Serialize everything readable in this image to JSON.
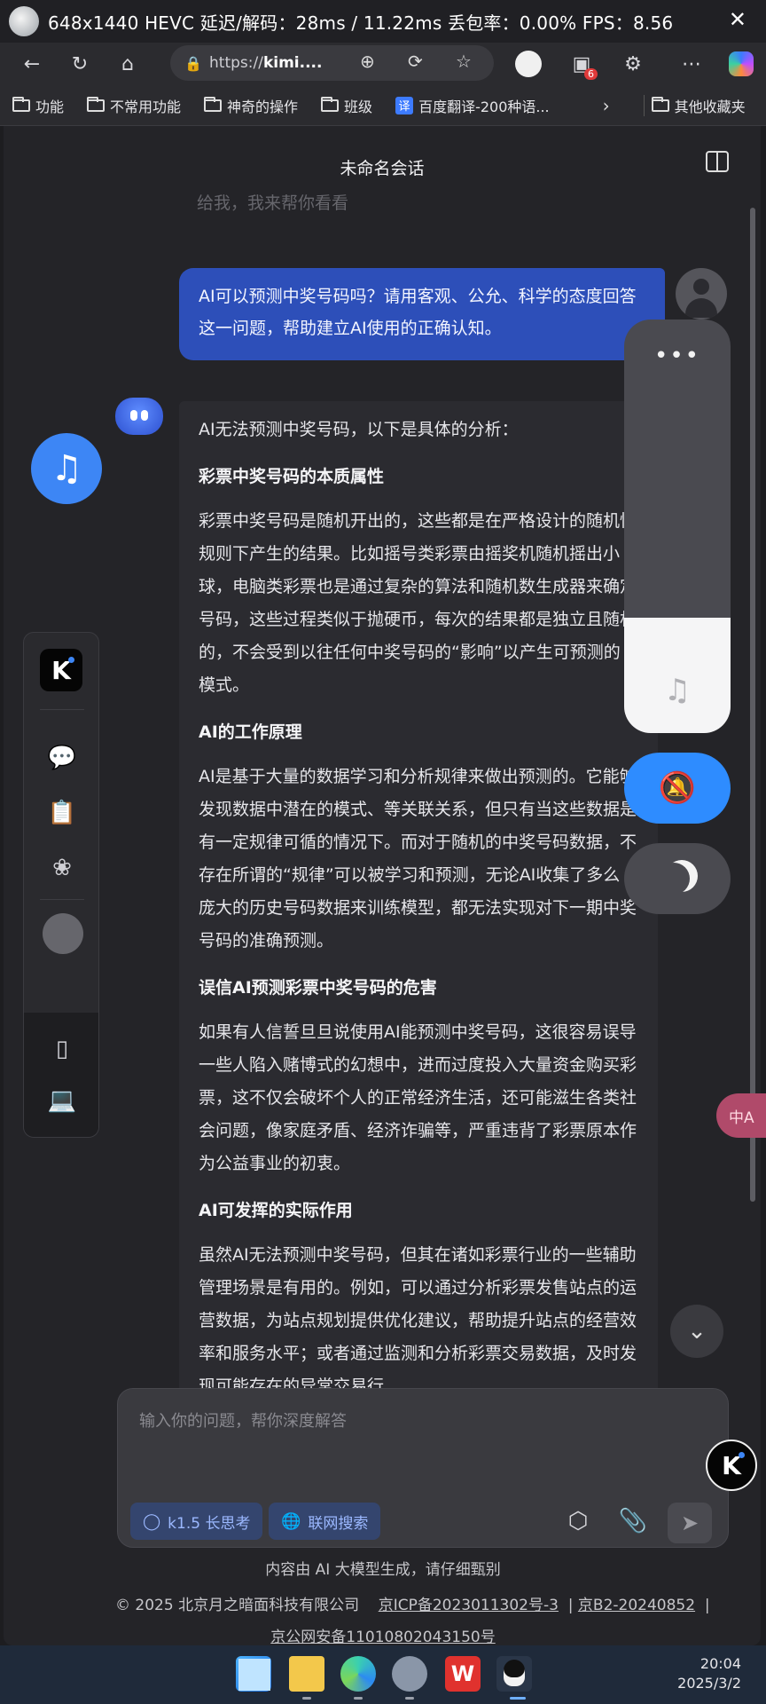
{
  "overlay": {
    "stats": "648x1440  HEVC  延迟/解码：28ms / 11.22ms   丢包率：0.00%  FPS：8.56",
    "close": "✕"
  },
  "toolbar": {
    "url_prefix": "https://",
    "url_host": "kimi...."
  },
  "bookmarks": [
    {
      "label": "功能",
      "icon": "folder-icon"
    },
    {
      "label": "不常用功能",
      "icon": "folder-icon"
    },
    {
      "label": "神奇的操作",
      "icon": "folder-icon"
    },
    {
      "label": "班级",
      "icon": "folder-icon"
    },
    {
      "label": "百度翻译-200种语...",
      "icon": "translate-icon",
      "icon_text": "译"
    },
    {
      "label": "其他收藏夹",
      "icon": "folder-icon"
    }
  ],
  "extension_badge": "6",
  "conversation": {
    "title": "未命名会话",
    "faded_previous": "给我，我来帮你看看",
    "user_message": "AI可以预测中奖号码吗？请用客观、公允、科学的态度回答这一问题，帮助建立AI使用的正确认知。",
    "assistant": {
      "intro": "AI无法预测中奖号码，以下是具体的分析：",
      "sections": [
        {
          "heading": "彩票中奖号码的本质属性",
          "body": "彩票中奖号码是随机开出的，这些都是在严格设计的随机性规则下产生的结果。比如摇号类彩票由摇奖机随机摇出小球，电脑类彩票也是通过复杂的算法和随机数生成器来确定号码，这些过程类似于抛硬币，每次的结果都是独立且随机的，不会受到以往任何中奖号码的“影响”以产生可预测的模式。"
        },
        {
          "heading": "AI的工作原理",
          "body": "AI是基于大量的数据学习和分析规律来做出预测的。它能够发现数据中潜在的模式、等关联关系，但只有当这些数据是有一定规律可循的情况下。而对于随机的中奖号码数据，不存在所谓的“规律”可以被学习和预测，无论AI收集了多么庞大的历史号码数据来训练模型，都无法实现对下一期中奖号码的准确预测。"
        },
        {
          "heading": "误信AI预测彩票中奖号码的危害",
          "body": "如果有人信誓旦旦说使用AI能预测中奖号码，这很容易误导一些人陷入赌博式的幻想中，进而过度投入大量资金购买彩票，这不仅会破坏个人的正常经济生活，还可能滋生各类社会问题，像家庭矛盾、经济诈骗等，严重违背了彩票原本作为公益事业的初衷。"
        },
        {
          "heading": "AI可发挥的实际作用",
          "body": "虽然AI无法预测中奖号码，但其在诸如彩票行业的一些辅助管理场景是有用的。例如，可以通过分析彩票发售站点的运营数据，为站点规划提供优化建议，帮助提升站点的经营效率和服务水平；或者通过监测和分析彩票交易数据，及时发现可能存在的异常交易行"
        }
      ]
    }
  },
  "volume_level_percent": 28,
  "input": {
    "placeholder": "输入你的问题，帮你深度解答",
    "chip_think": "k1.5 长思考",
    "chip_search": "联网搜索"
  },
  "translate_fab": "中A",
  "footer": {
    "ai_note": "内容由 AI 大模型生成，请仔细甄别",
    "copyright": "© 2025 北京月之暗面科技有限公司",
    "icp": "京ICP备2023011302号-3",
    "b2": "京B2-20240852",
    "police": "京公网安备11010802043150号"
  },
  "taskbar": {
    "time": "20:04",
    "date": "2025/3/2",
    "wps_label": "W"
  }
}
